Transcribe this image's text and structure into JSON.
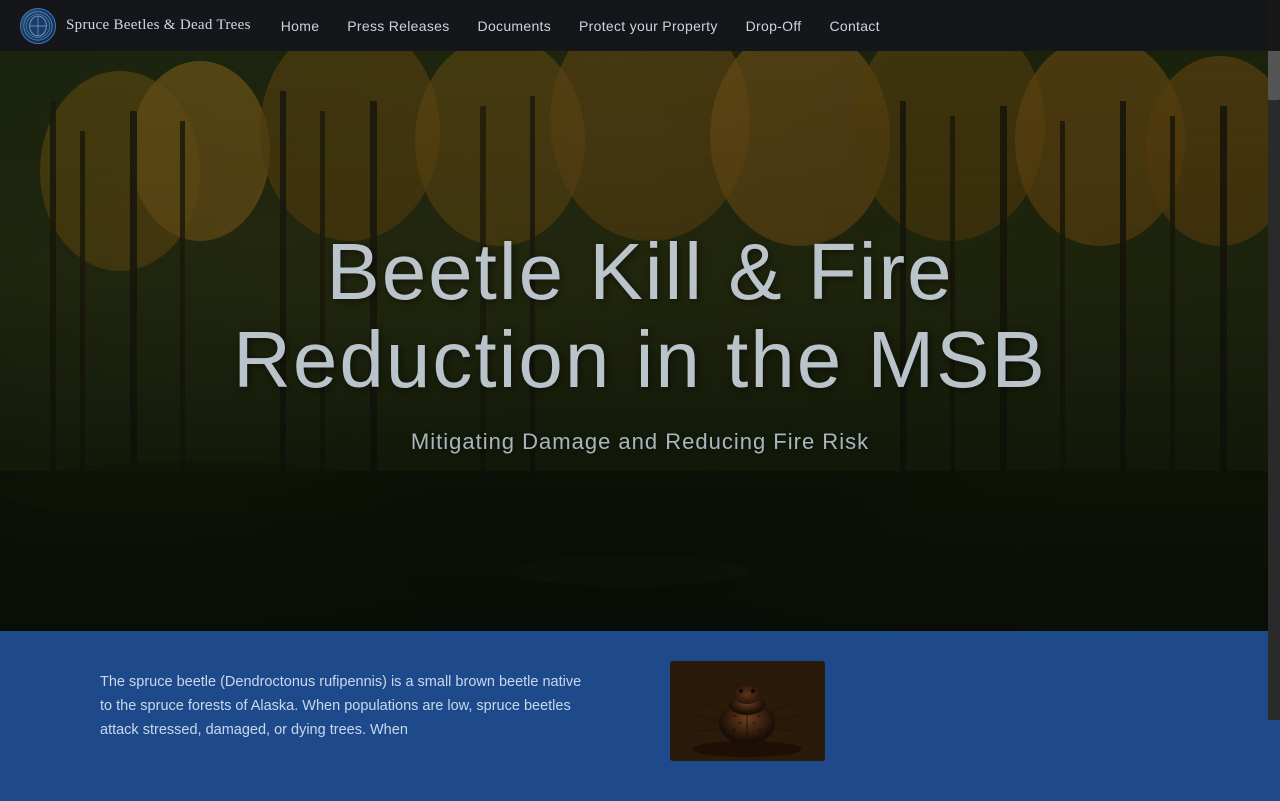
{
  "nav": {
    "site_title": "Spruce Beetles & Dead Trees",
    "links": [
      {
        "label": "Home",
        "href": "#"
      },
      {
        "label": "Press Releases",
        "href": "#"
      },
      {
        "label": "Documents",
        "href": "#"
      },
      {
        "label": "Protect your Property",
        "href": "#"
      },
      {
        "label": "Drop-Off",
        "href": "#"
      },
      {
        "label": "Contact",
        "href": "#"
      }
    ]
  },
  "hero": {
    "title_line1": "Beetle Kill & Fire",
    "title_line2": "Reduction in the MSB",
    "subtitle": "Mitigating Damage and Reducing Fire Risk"
  },
  "bottom": {
    "description": "The spruce beetle (Dendroctonus rufipennis) is a small brown beetle native to the spruce forests of Alaska. When populations are low, spruce beetles attack stressed, damaged, or dying trees.  When"
  }
}
